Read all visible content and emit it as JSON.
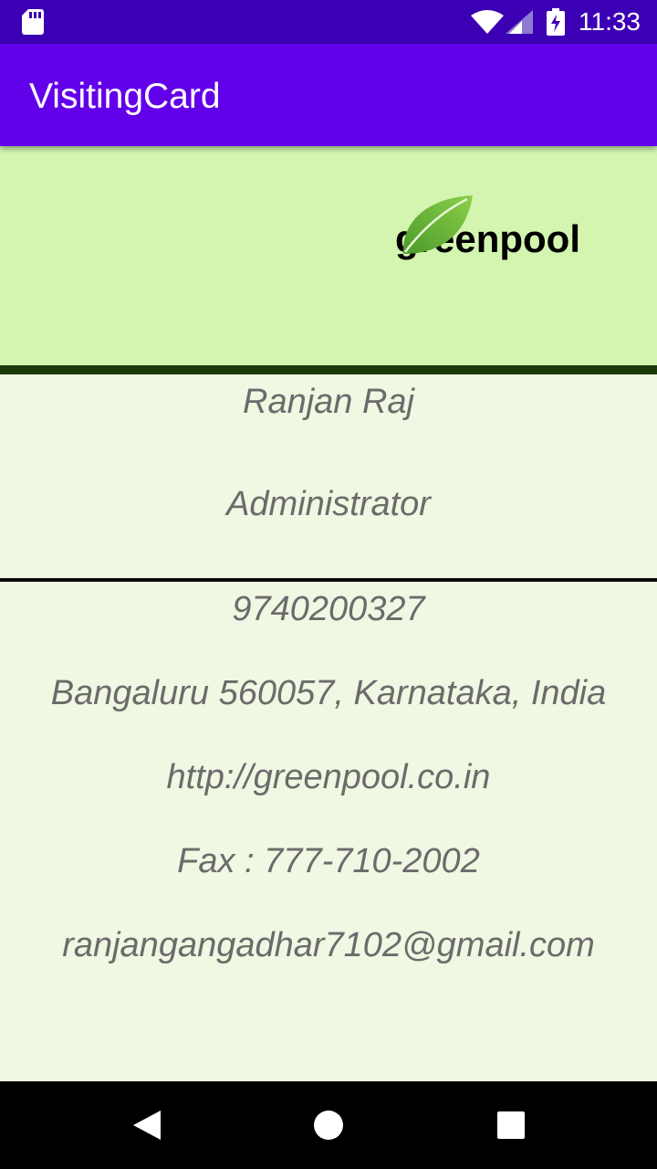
{
  "status_bar": {
    "time": "11:33",
    "icons": [
      "sd-card-icon",
      "wifi-icon",
      "signal-icon",
      "battery-charging-icon"
    ]
  },
  "app_bar": {
    "title": "VisitingCard",
    "color": "#6200ea"
  },
  "card": {
    "company": "greenpool",
    "logo_icon": "leaf-icon",
    "header_color": "#d3f5b0",
    "body_color": "#f0f7e2",
    "name": "Ranjan Raj",
    "role": "Administrator",
    "phone": "9740200327",
    "address": "Bangaluru 560057, Karnataka, India",
    "website": "http://greenpool.co.in",
    "fax": "Fax : 777-710-2002",
    "email": "ranjangangadhar7102@gmail.com"
  },
  "nav_bar": {
    "icons": [
      "back-icon",
      "home-icon",
      "recents-icon"
    ]
  }
}
